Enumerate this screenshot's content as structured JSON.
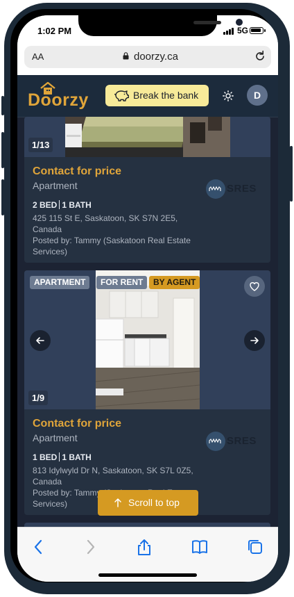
{
  "status_bar": {
    "time": "1:02 PM",
    "network": "5G"
  },
  "browser": {
    "text_size": "AA",
    "url": "doorzy.ca"
  },
  "header": {
    "logo": "Doorzy",
    "promo_button": "Break the bank",
    "avatar_initial": "D"
  },
  "listings": [
    {
      "photo_counter": "1/13",
      "price": "Contact for price",
      "property_type": "Apartment",
      "beds": "2 BED",
      "baths": "1 BATH",
      "address": "425 115 St E, Saskatoon, SK S7N 2E5, Canada",
      "posted_by": "Posted by: Tammy (Saskatoon Real Estate Services)",
      "agency_logo": "SRES"
    },
    {
      "tags": [
        "APARTMENT",
        "FOR RENT",
        "BY AGENT"
      ],
      "photo_counter": "1/9",
      "price": "Contact for price",
      "property_type": "Apartment",
      "beds": "1 BED",
      "baths": "1 BATH",
      "address": "813 Idylwyld Dr N, Saskatoon, SK S7L 0Z5, Canada",
      "posted_by": "Posted by: Tammy (Saskatoon Real Estate Services)",
      "agency_logo": "SRES"
    }
  ],
  "scroll_to_top": "Scroll to top",
  "colors": {
    "accent": "#e0a53a",
    "promo": "#f7ea99",
    "card": "#253141",
    "header": "#1c2b3c",
    "page": "#1c2333"
  },
  "icons": [
    "lock-icon",
    "reload-icon",
    "piggy-bank-icon",
    "sun-icon",
    "heart-icon",
    "chevron-left-icon",
    "chevron-right-icon",
    "arrow-up-icon",
    "back-icon",
    "forward-icon",
    "share-icon",
    "bookmarks-icon",
    "tabs-icon"
  ]
}
